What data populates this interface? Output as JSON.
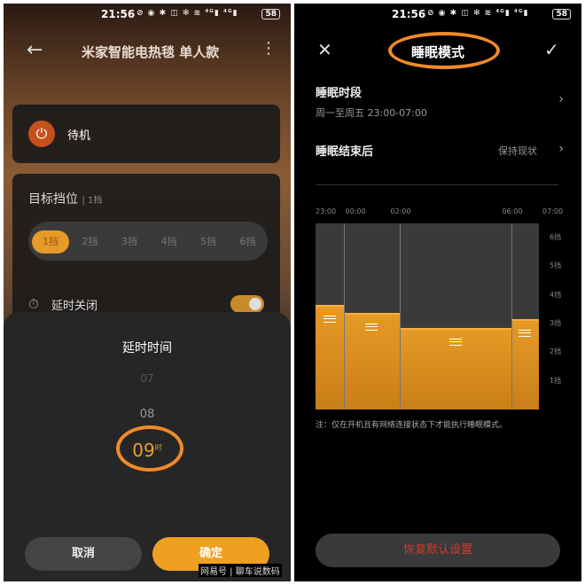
{
  "status": {
    "time": "21:56",
    "icons": "⊘ ◉ ✱ ◫ ✻ ≋ ⁴ᴳ▮ ⁴ᴳ▮",
    "battery": "58"
  },
  "left": {
    "header": {
      "back": "←",
      "title": "米家智能电热毯 单人款",
      "more": "⋮"
    },
    "power": {
      "icon": "⏻",
      "state": "待机"
    },
    "gear": {
      "label": "目标挡位",
      "sub": "| 1挡",
      "options": [
        "1挡",
        "2挡",
        "3挡",
        "4挡",
        "5挡",
        "6挡"
      ],
      "selected": 0
    },
    "delay": {
      "icon": "⏱",
      "label": "延时关闭",
      "enabled": true
    },
    "sheet": {
      "title": "延时时间",
      "picker": {
        "prev2": "07",
        "prev1": "08",
        "selected": "09",
        "unit": "时"
      },
      "cancel": "取消",
      "confirm": "确定"
    }
  },
  "right": {
    "header": {
      "close": "✕",
      "title": "睡眠模式",
      "check": "✓"
    },
    "period": {
      "title": "睡眠时段",
      "sub": "周一至周五 23:00-07:00",
      "chevron": "›"
    },
    "after": {
      "title": "睡眠结束后",
      "value": "保持现状",
      "chevron": "›"
    },
    "note": "注：仅在开机且有网络连接状态下才能执行睡眠模式。",
    "reset": "恢复默认设置"
  },
  "chart_data": {
    "type": "bar",
    "x_ticks": [
      "23:00",
      "00:00",
      "02:00",
      "06:00",
      "07:00"
    ],
    "y_ticks": [
      "6挡",
      "5挡",
      "4挡",
      "3挡",
      "2挡",
      "1挡"
    ],
    "segments": [
      {
        "from": "23:00",
        "to": "00:00",
        "level": 3.6
      },
      {
        "from": "00:00",
        "to": "02:00",
        "level": 3.3
      },
      {
        "from": "02:00",
        "to": "06:00",
        "level": 2.8
      },
      {
        "from": "06:00",
        "to": "07:00",
        "level": 3.1
      }
    ],
    "ylim": [
      0,
      6.5
    ]
  },
  "watermark": "网易号 | 聊车说数码",
  "colors": {
    "accent": "#f0a020",
    "ring": "#f08a2a",
    "reset_text": "#d23a2a"
  }
}
